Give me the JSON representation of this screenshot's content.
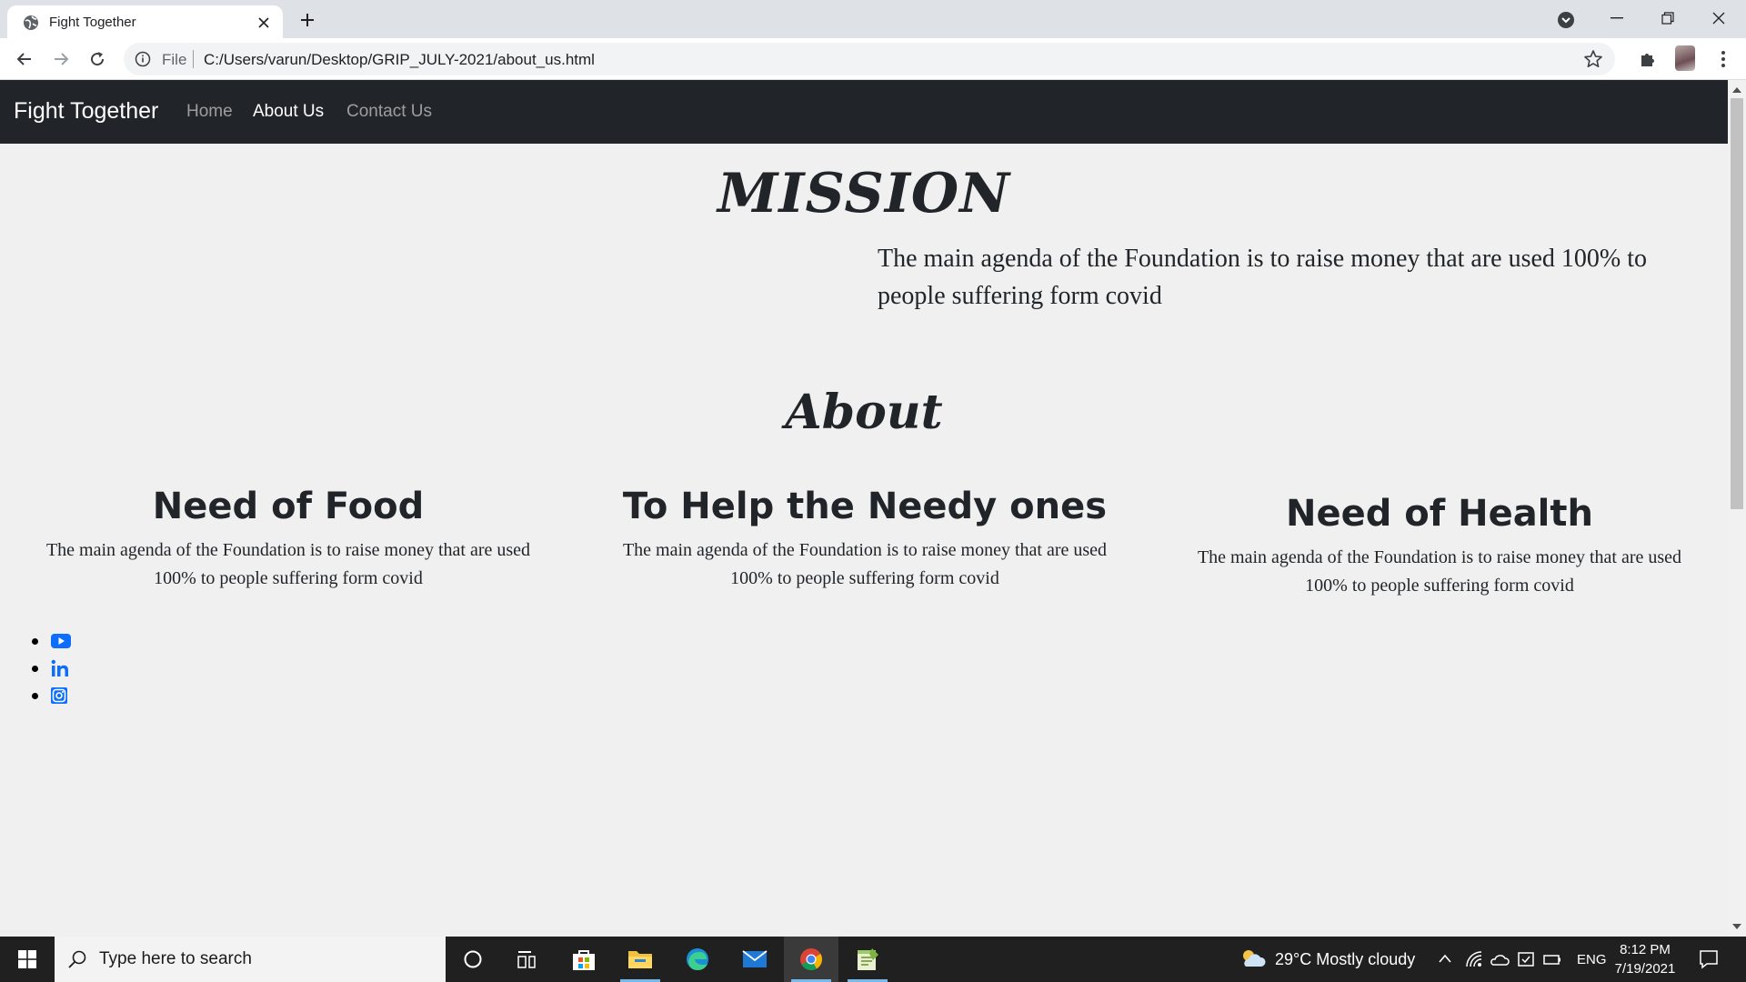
{
  "browser": {
    "tab_title": "Fight Together",
    "omnibox_scheme": "File",
    "url": "C:/Users/varun/Desktop/GRIP_JULY-2021/about_us.html"
  },
  "site": {
    "brand": "Fight Together",
    "nav": [
      "Home",
      "About Us",
      "Contact Us"
    ],
    "active_nav": "About Us",
    "mission": {
      "title": "MISSION",
      "text": "The main agenda of the Foundation is to raise money that are used 100% to people suffering form covid"
    },
    "about": {
      "title": "About",
      "columns": [
        {
          "heading": "Need of Food",
          "text": "The main agenda of the Foundation is to raise money that are used 100% to people suffering form covid"
        },
        {
          "heading": "To Help the Needy ones",
          "text": "The main agenda of the Foundation is to raise money that are used 100% to people suffering form covid"
        },
        {
          "heading": "Need of Health",
          "text": "The main agenda of the Foundation is to raise money that are used 100% to people suffering form covid"
        }
      ]
    },
    "social": [
      "youtube-icon",
      "linkedin-icon",
      "instagram-icon"
    ],
    "accent": "#0d6efd"
  },
  "taskbar": {
    "search_placeholder": "Type here to search",
    "weather": "29°C  Mostly cloudy",
    "language": "ENG",
    "time": "8:12 PM",
    "date": "7/19/2021"
  }
}
